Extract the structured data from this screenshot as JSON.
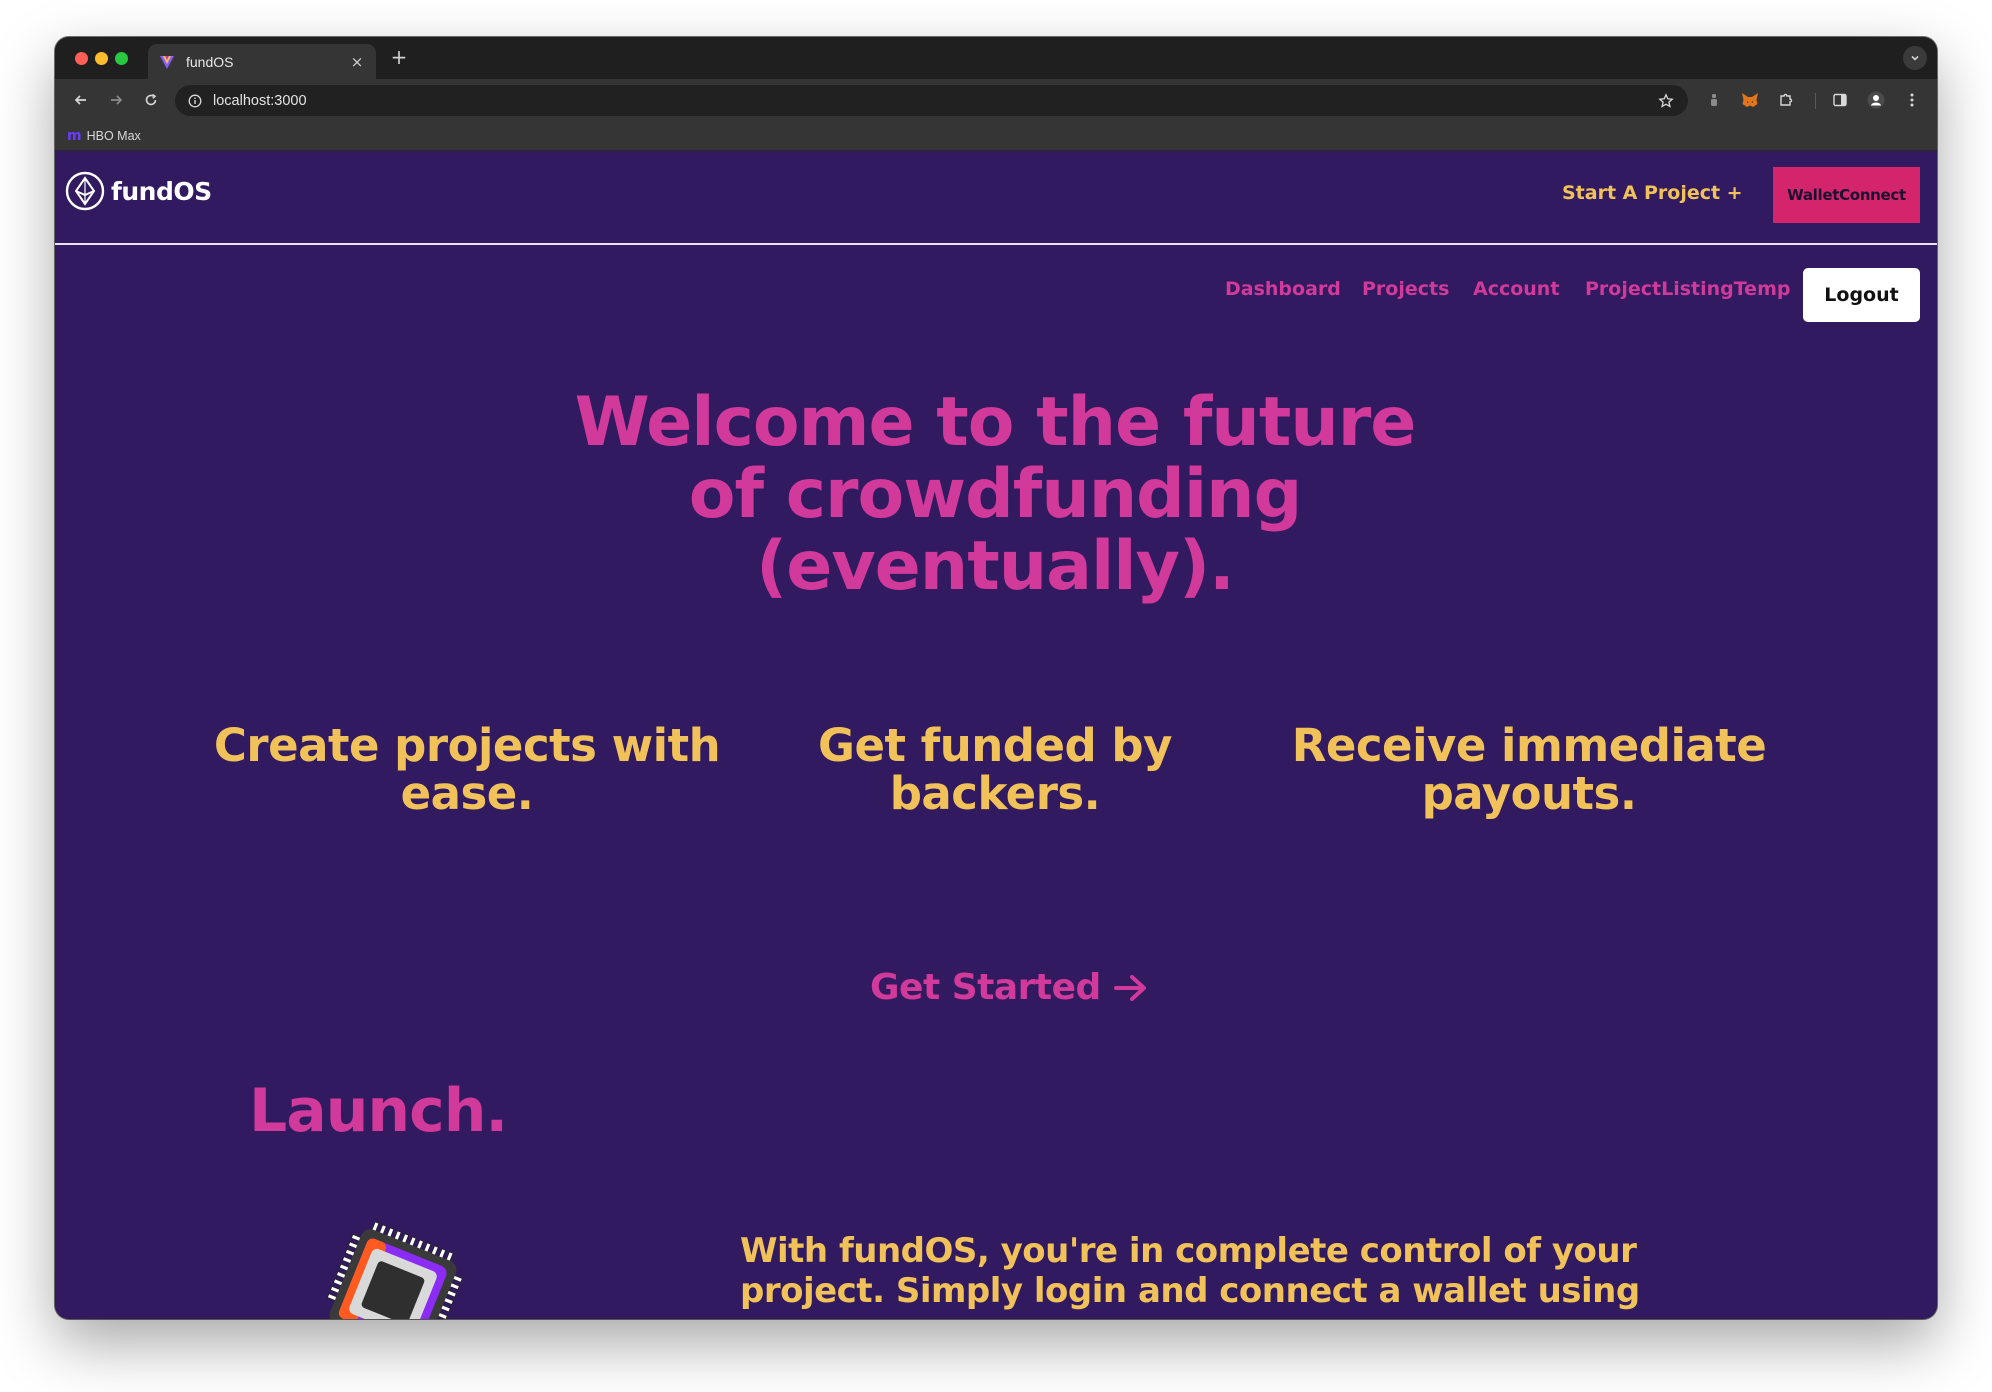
{
  "browser": {
    "tab": {
      "title": "fundOS",
      "close_glyph": "×",
      "favicon": "fundos-favicon-icon"
    },
    "new_tab_glyph": "+",
    "address": {
      "url": "localhost:3000"
    },
    "bookmarks": [
      {
        "label": "HBO Max",
        "icon_glyph": "m"
      }
    ],
    "colors": {
      "tabbar": "#1f1f1f",
      "toolbar": "#353535",
      "omnibox": "#212121"
    }
  },
  "header": {
    "logo_text": "fundOS",
    "start_project": "Start A Project +",
    "wallet_button": "WalletConnect"
  },
  "subnav": {
    "links": [
      "Dashboard",
      "Projects",
      "Account",
      "ProjectListingTemp"
    ],
    "logout": "Logout"
  },
  "hero": {
    "lines": [
      "Welcome to the future",
      "of crowdfunding",
      "(eventually)."
    ]
  },
  "features": [
    {
      "lines": [
        "Create projects with",
        "ease."
      ]
    },
    {
      "lines": [
        "Get funded by",
        "backers."
      ]
    },
    {
      "lines": [
        "Receive immediate",
        "payouts."
      ]
    }
  ],
  "cta": {
    "label": "Get Started"
  },
  "launch": {
    "title": "Launch.",
    "text_lines": [
      "With fundOS, you're in complete control of your",
      "project. Simply login and connect a wallet using"
    ]
  },
  "colors": {
    "page_background": "#311a5f",
    "pink": "#d1399a",
    "gold": "#f2c25a",
    "wallet_button": "#d3246c",
    "logout_button": "#ffffff"
  }
}
